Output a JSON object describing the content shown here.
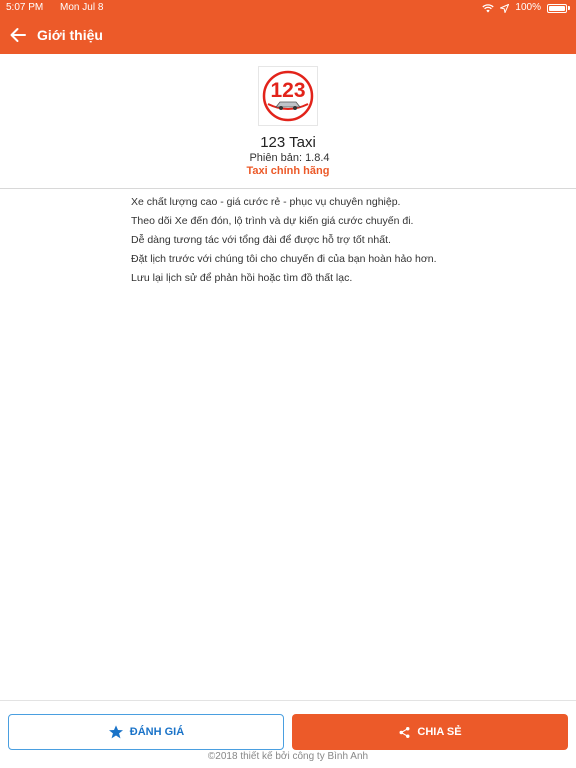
{
  "status_bar": {
    "time": "5:07 PM",
    "date": "Mon Jul 8",
    "battery": "100%"
  },
  "nav": {
    "title": "Giới thiệu"
  },
  "app": {
    "logo_text": "123",
    "name": "123 Taxi",
    "version_label": "Phiên bản:",
    "version": "1.8.4",
    "official_label": "Taxi chính hãng"
  },
  "features": [
    "Xe chất lượng cao - giá cước rẻ - phục vụ chuyên nghiệp.",
    "Theo dõi Xe đến đón, lộ trình và dự kiến giá cước chuyến đi.",
    "Dễ dàng tương tác với tổng đài để được hỗ trợ tốt nhất.",
    "Đặt lịch trước với chúng tôi cho chuyến đi của bạn hoàn hảo hơn.",
    "Lưu lại lịch sử để phản hồi hoặc tìm đồ thất lạc."
  ],
  "actions": {
    "rate_label": "ĐÁNH GIÁ",
    "share_label": "CHIA SẺ"
  },
  "footer": {
    "text": "©2018 thiết kế bởi công ty Bình Anh"
  },
  "colors": {
    "brand": "#ec5a29",
    "rate_accent": "#1a73c8",
    "icons": [
      "wifi-icon",
      "location-arrow-icon",
      "battery-icon",
      "back-arrow-icon",
      "star-icon",
      "share-icon"
    ]
  }
}
